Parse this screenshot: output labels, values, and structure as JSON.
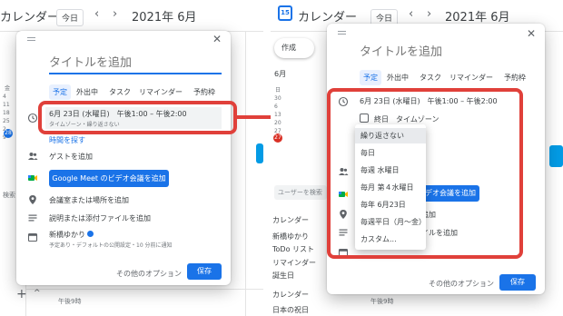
{
  "left": {
    "header": {
      "title": "カレンダー",
      "today_label": "今日",
      "prev": "‹",
      "next": "›",
      "month": "2021年 6月"
    },
    "mini_cal": {
      "day_header": "金",
      "weeks": [
        "4",
        "11",
        "18",
        "25",
        "2",
        "9"
      ],
      "today": "28"
    },
    "search_people": "検索",
    "dialog": {
      "title_placeholder": "タイトルを追加",
      "tabs": [
        "予定",
        "外出中",
        "タスク",
        "リマインダー",
        "予約枠"
      ],
      "date_line": "6月 23日 (水曜日)　午後1:00 – 午後2:00",
      "date_sub": "タイムゾーン・繰り返さない",
      "find_time": "時間を探す",
      "add_guests": "ゲストを追加",
      "meet_button": "Google Meet のビデオ会議を追加",
      "add_room": "会議室または場所を追加",
      "add_desc": "説明または添付ファイルを追加",
      "calendar_name": "新橋ゆかり",
      "calendar_sub": "予定あり・デフォルトの公開設定・10 分前に通知",
      "more_options": "その他のオプション",
      "save": "保存"
    },
    "time_label": "午後9時",
    "add_plus": "+",
    "chevron_up": "^"
  },
  "right": {
    "header": {
      "badge": "15",
      "title": "カレンダー",
      "today_label": "今日",
      "prev": "‹",
      "next": "›",
      "month": "2021年 6月"
    },
    "create_label": "作成",
    "month_label": "6月",
    "mini_cal": {
      "day_header": "日",
      "weeks": [
        "30",
        "6",
        "13",
        "20",
        "27",
        "4"
      ],
      "today": "27"
    },
    "search_people": "ユーザーを検索",
    "side_items": [
      "カレンダー",
      "新橋ゆかり",
      "ToDo リスト",
      "リマインダー",
      "誕生日",
      "カレンダー",
      "日本の祝日"
    ],
    "dialog": {
      "title_placeholder": "タイトルを追加",
      "tabs": [
        "予定",
        "外出中",
        "タスク",
        "リマインダー",
        "予約枠"
      ],
      "date_line": "6月 23日 (水曜日)　午後1:00 – 午後2:00",
      "allday_label": "終日",
      "timezone_label": "タイムゾーン",
      "meet_button_partial": "デオ会議を追加",
      "partial_room": "追加",
      "partial_desc": "イルを追加",
      "more_options": "その他のオプション",
      "save": "保存"
    },
    "repeat_options": [
      "繰り返さない",
      "毎日",
      "毎週 水曜日",
      "毎月 第４水曜日",
      "毎年 6月23日",
      "毎週平日（月～金）",
      "カスタム..."
    ],
    "time_label": "午後9時"
  },
  "accent_red": "#e0403a",
  "accent_blue": "#1a73e8"
}
